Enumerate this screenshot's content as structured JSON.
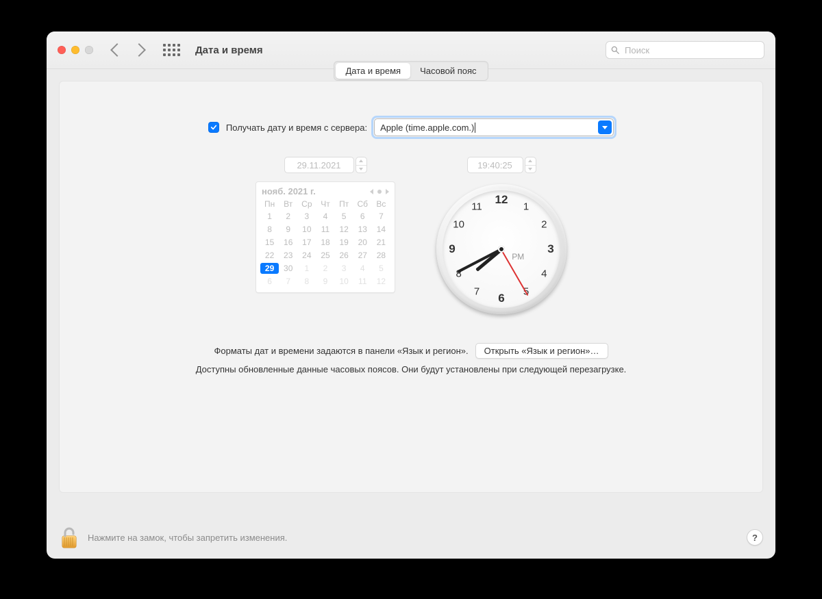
{
  "window": {
    "title": "Дата и время",
    "search_placeholder": "Поиск"
  },
  "tabs": {
    "date_time": "Дата и время",
    "timezone": "Часовой пояс"
  },
  "auto": {
    "label": "Получать дату и время с сервера:",
    "server": "Apple (time.apple.com.)"
  },
  "date_field": "29.11.2021",
  "time_field": "19:40:25",
  "calendar": {
    "month_label": "нояб. 2021 г.",
    "dow": [
      "Пн",
      "Вт",
      "Ср",
      "Чт",
      "Пт",
      "Сб",
      "Вс"
    ],
    "weeks": [
      [
        {
          "d": 1
        },
        {
          "d": 2
        },
        {
          "d": 3
        },
        {
          "d": 4
        },
        {
          "d": 5
        },
        {
          "d": 6
        },
        {
          "d": 7
        }
      ],
      [
        {
          "d": 8
        },
        {
          "d": 9
        },
        {
          "d": 10
        },
        {
          "d": 11
        },
        {
          "d": 12
        },
        {
          "d": 13
        },
        {
          "d": 14
        }
      ],
      [
        {
          "d": 15
        },
        {
          "d": 16
        },
        {
          "d": 17
        },
        {
          "d": 18
        },
        {
          "d": 19
        },
        {
          "d": 20
        },
        {
          "d": 21
        }
      ],
      [
        {
          "d": 22
        },
        {
          "d": 23
        },
        {
          "d": 24
        },
        {
          "d": 25
        },
        {
          "d": 26
        },
        {
          "d": 27
        },
        {
          "d": 28
        }
      ],
      [
        {
          "d": 29,
          "today": true
        },
        {
          "d": 30
        },
        {
          "d": 1,
          "other": true
        },
        {
          "d": 2,
          "other": true
        },
        {
          "d": 3,
          "other": true
        },
        {
          "d": 4,
          "other": true
        },
        {
          "d": 5,
          "other": true
        }
      ],
      [
        {
          "d": 6,
          "other": true
        },
        {
          "d": 7,
          "other": true
        },
        {
          "d": 8,
          "other": true
        },
        {
          "d": 9,
          "other": true
        },
        {
          "d": 10,
          "other": true
        },
        {
          "d": 11,
          "other": true
        },
        {
          "d": 12,
          "other": true
        }
      ]
    ]
  },
  "clock": {
    "ampm": "PM",
    "hour": 19,
    "minute": 40,
    "second": 25,
    "numbers": [
      "12",
      "1",
      "2",
      "3",
      "4",
      "5",
      "6",
      "7",
      "8",
      "9",
      "10",
      "11"
    ]
  },
  "footer": {
    "formats_text": "Форматы дат и времени задаются в панели «Язык и регион».",
    "open_button": "Открыть «Язык и регион»…",
    "update_text": "Доступны обновленные данные часовых поясов. Они будут установлены при следующей перезагрузке."
  },
  "lock_hint": "Нажмите на замок, чтобы запретить изменения.",
  "help": "?"
}
